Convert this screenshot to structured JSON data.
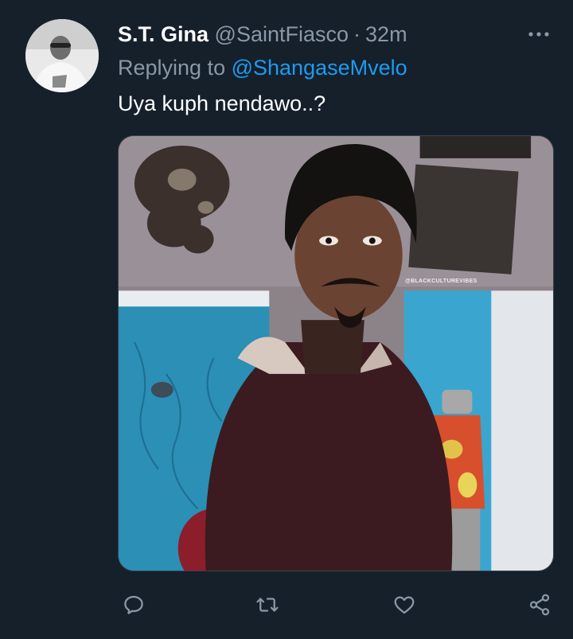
{
  "tweet": {
    "display_name": "S.T. Gina",
    "handle": "@SaintFiasco",
    "separator": "·",
    "time": "32m",
    "replying_prefix": "Replying to",
    "replying_to": "@ShangaseMvelo",
    "text": "Uya kuph nendawo..?",
    "media_watermark": "@BLACKCULTUREVIBES"
  },
  "icons": {
    "more": "more-horizontal-icon",
    "reply": "reply-icon",
    "retweet": "retweet-icon",
    "like": "heart-icon",
    "share": "share-icon"
  },
  "colors": {
    "background": "#15202b",
    "primary_text": "#ffffff",
    "secondary_text": "#8b98a5",
    "accent": "#1d9bf0"
  }
}
